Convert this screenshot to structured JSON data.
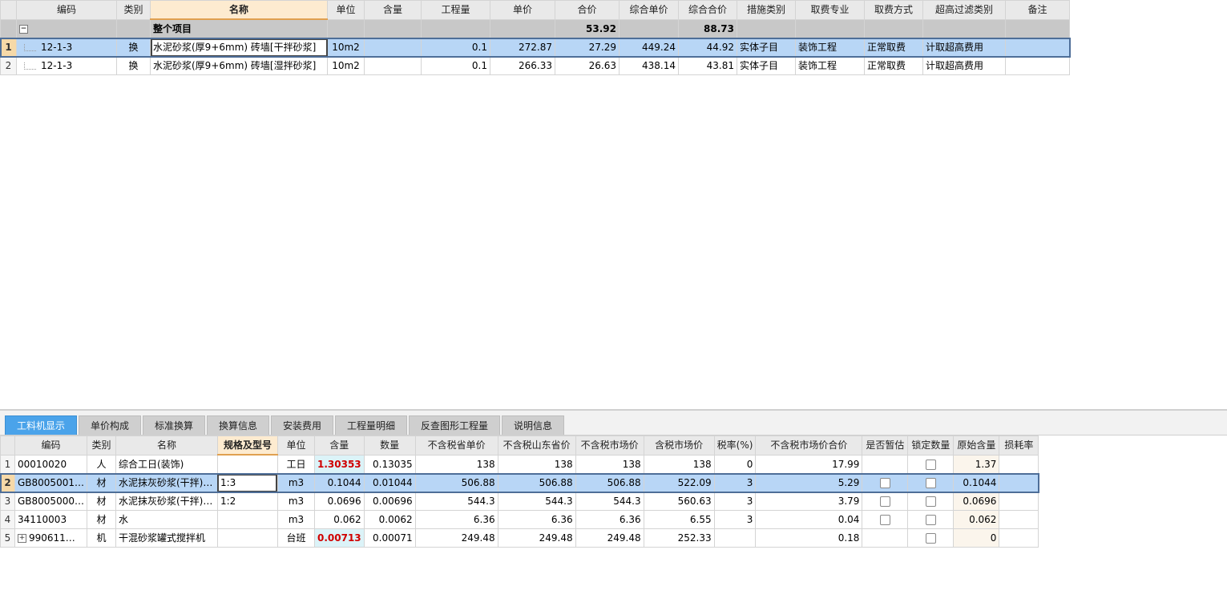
{
  "top_grid": {
    "columns": [
      "编码",
      "类别",
      "名称",
      "单位",
      "含量",
      "工程量",
      "单价",
      "合价",
      "综合单价",
      "综合合价",
      "措施类别",
      "取费专业",
      "取费方式",
      "超高过滤类别",
      "备注"
    ],
    "group_row": {
      "expand_symbol": "−",
      "label": "整个项目",
      "total": "53.92",
      "comp_total": "88.73"
    },
    "rows": [
      {
        "num": "1",
        "code": "12-1-3",
        "type": "换",
        "name": "水泥砂浆(厚9+6mm) 砖墙[干拌砂浆]",
        "unit": "10m2",
        "content": "",
        "qty": "0.1",
        "price": "272.87",
        "total": "27.29",
        "comp_price": "449.24",
        "comp_total": "44.92",
        "measure": "实体子目",
        "fee_major": "装饰工程",
        "fee_method": "正常取费",
        "over_filter": "计取超高费用",
        "note": ""
      },
      {
        "num": "2",
        "code": "12-1-3",
        "type": "换",
        "name": "水泥砂浆(厚9+6mm) 砖墙[湿拌砂浆]",
        "unit": "10m2",
        "content": "",
        "qty": "0.1",
        "price": "266.33",
        "total": "26.63",
        "comp_price": "438.14",
        "comp_total": "43.81",
        "measure": "实体子目",
        "fee_major": "装饰工程",
        "fee_method": "正常取费",
        "over_filter": "计取超高费用",
        "note": ""
      }
    ]
  },
  "tabs": [
    "工料机显示",
    "单价构成",
    "标准换算",
    "换算信息",
    "安装费用",
    "工程量明细",
    "反查图形工程量",
    "说明信息"
  ],
  "bottom_grid": {
    "columns": [
      "编码",
      "类别",
      "名称",
      "规格及型号",
      "单位",
      "含量",
      "数量",
      "不含税省单价",
      "不含税山东省价",
      "不含税市场价",
      "含税市场价",
      "税率(%)",
      "不含税市场价合价",
      "是否暂估",
      "锁定数量",
      "原始含量",
      "损耗率"
    ],
    "rows": [
      {
        "num": "1",
        "code": "00010020",
        "type": "人",
        "name": "综合工日(装饰)",
        "spec": "",
        "unit": "工日",
        "content": "1.30353",
        "qty": "0.13035",
        "p1": "138",
        "p2": "138",
        "p3": "138",
        "p4": "138",
        "tax": "0",
        "sum": "17.99",
        "orig": "1.37",
        "loss": ""
      },
      {
        "num": "2",
        "code": "GB8005001…",
        "type": "材",
        "name": "水泥抹灰砂浆(干拌)…",
        "spec": "1:3",
        "unit": "m3",
        "content": "0.1044",
        "qty": "0.01044",
        "p1": "506.88",
        "p2": "506.88",
        "p3": "506.88",
        "p4": "522.09",
        "tax": "3",
        "sum": "5.29",
        "orig": "0.1044",
        "loss": ""
      },
      {
        "num": "3",
        "code": "GB8005000…",
        "type": "材",
        "name": "水泥抹灰砂浆(干拌)…",
        "spec": "1:2",
        "unit": "m3",
        "content": "0.0696",
        "qty": "0.00696",
        "p1": "544.3",
        "p2": "544.3",
        "p3": "544.3",
        "p4": "560.63",
        "tax": "3",
        "sum": "3.79",
        "orig": "0.0696",
        "loss": ""
      },
      {
        "num": "4",
        "code": "34110003",
        "type": "材",
        "name": "水",
        "spec": "",
        "unit": "m3",
        "content": "0.062",
        "qty": "0.0062",
        "p1": "6.36",
        "p2": "6.36",
        "p3": "6.36",
        "p4": "6.55",
        "tax": "3",
        "sum": "0.04",
        "orig": "0.062",
        "loss": ""
      },
      {
        "num": "5",
        "code": "990611…",
        "type": "机",
        "name": "干混砂浆罐式搅拌机",
        "spec": "",
        "unit": "台班",
        "content": "0.00713",
        "qty": "0.00071",
        "p1": "249.48",
        "p2": "249.48",
        "p3": "249.48",
        "p4": "252.33",
        "tax": "",
        "sum": "0.18",
        "orig": "0",
        "loss": ""
      }
    ],
    "expand_symbol": "+"
  }
}
